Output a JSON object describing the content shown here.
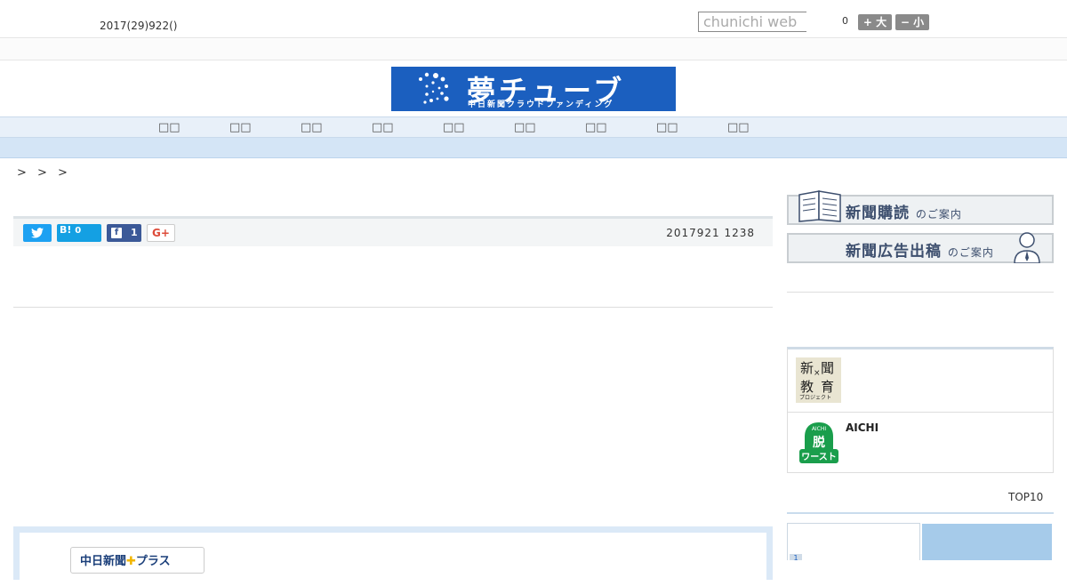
{
  "header": {
    "date": "2017(29)922()",
    "search_placeholder": "chunichi web",
    "counter": "0",
    "font_big": "+ 大",
    "font_small": "− 小"
  },
  "logo": {
    "title": "夢チューブ",
    "subtitle": "中日新聞クラウドファンディング",
    "brand_color": "#1b5fbf"
  },
  "nav": {
    "items": [
      "□□",
      "□□",
      "□□",
      "□□",
      "□□",
      "□□",
      "□□",
      "□□",
      "□□"
    ]
  },
  "breadcrumb": "> > >",
  "share": {
    "twitter_icon": "twitter-icon",
    "hatena_label": "B!",
    "hatena_count": "0",
    "facebook_icon": "f",
    "facebook_count": "1",
    "gplus_label": "G+",
    "published": "2017921 1238"
  },
  "plus_badge": {
    "text": "中日新聞",
    "star": "✚",
    "suffix": "プラス"
  },
  "sidebar": {
    "subscribe_main": "新聞購読",
    "subscribe_suffix": "のご案内",
    "ad_main": "新聞広告出稿",
    "ad_suffix": "のご案内",
    "edu_chars": [
      "新",
      "聞",
      "×",
      "教",
      "育"
    ],
    "edu_sub": "プロジェクト",
    "aichi_label": "AICHI",
    "aichi_badge_top": "AICHI",
    "aichi_badge_mid": "脱",
    "aichi_badge_bottom": "ワースト",
    "top10": "TOP10",
    "rank_first": "1"
  },
  "colors": {
    "nav_bg": "#e8f0f9",
    "tab_active": "#a6cbea",
    "twitter": "#1da1f2",
    "facebook": "#3b5998"
  }
}
